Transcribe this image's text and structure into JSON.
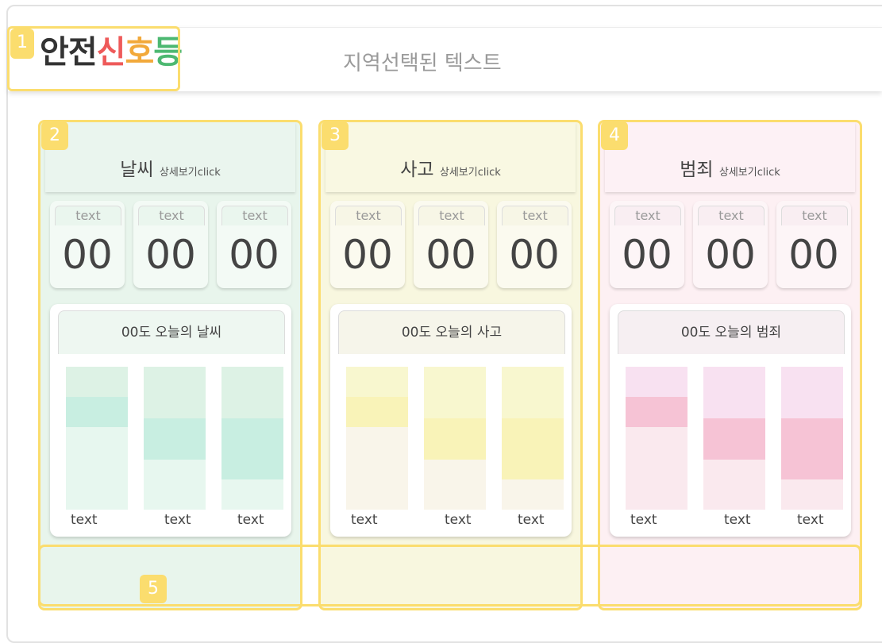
{
  "header": {
    "logo_chars": [
      "안",
      "전",
      "신",
      "호",
      "등"
    ],
    "logo_colors": [
      "#333333",
      "#333333",
      "#ee5a5a",
      "#f2a93b",
      "#4cb871"
    ],
    "region_text": "지역선택된 텍스트"
  },
  "annotations": [
    "1",
    "2",
    "3",
    "4",
    "5"
  ],
  "panels": [
    {
      "title": "날씨",
      "detail": "상세보기click",
      "theme": {
        "bg": "#e8f5ec",
        "head": "#eaf5ee",
        "stat_bg": "#f3faf5",
        "stat_top": "#eaf6ee",
        "chart_head": "#eef7f1",
        "bar_base": "#e7f7ef",
        "bar_top": "#ddf2e5",
        "bar_fill": "#c8eee1"
      },
      "stats": [
        {
          "label": "text",
          "value": "00"
        },
        {
          "label": "text",
          "value": "00"
        },
        {
          "label": "text",
          "value": "00"
        }
      ],
      "chart_title": "00도 오늘의 날씨",
      "bars": [
        {
          "label": "text",
          "top": 0.21,
          "fill": 0.21
        },
        {
          "label": "text",
          "top": 0.36,
          "fill": 0.29
        },
        {
          "label": "text",
          "top": 0.36,
          "fill": 0.43
        }
      ]
    },
    {
      "title": "사고",
      "detail": "상세보기click",
      "theme": {
        "bg": "#f8f7df",
        "head": "#f9f8e2",
        "stat_bg": "#fbfaef",
        "stat_top": "#f7f6e6",
        "chart_head": "#f6f5ea",
        "bar_base": "#f9f5ea",
        "bar_top": "#f8f7cf",
        "bar_fill": "#f9f3b8"
      },
      "stats": [
        {
          "label": "text",
          "value": "00"
        },
        {
          "label": "text",
          "value": "00"
        },
        {
          "label": "text",
          "value": "00"
        }
      ],
      "chart_title": "00도 오늘의 사고",
      "bars": [
        {
          "label": "text",
          "top": 0.21,
          "fill": 0.21
        },
        {
          "label": "text",
          "top": 0.36,
          "fill": 0.29
        },
        {
          "label": "text",
          "top": 0.36,
          "fill": 0.43
        }
      ]
    },
    {
      "title": "범죄",
      "detail": "상세보기click",
      "theme": {
        "bg": "#fdf0f3",
        "head": "#fdf1f5",
        "stat_bg": "#fdf5f7",
        "stat_top": "#f9eef2",
        "chart_head": "#f6eff2",
        "bar_base": "#fae9ee",
        "bar_top": "#f8e1f1",
        "bar_fill": "#f6c3d5"
      },
      "stats": [
        {
          "label": "text",
          "value": "00"
        },
        {
          "label": "text",
          "value": "00"
        },
        {
          "label": "text",
          "value": "00"
        }
      ],
      "chart_title": "00도 오늘의 범죄",
      "bars": [
        {
          "label": "text",
          "top": 0.21,
          "fill": 0.21
        },
        {
          "label": "text",
          "top": 0.36,
          "fill": 0.29
        },
        {
          "label": "text",
          "top": 0.36,
          "fill": 0.43
        }
      ]
    }
  ]
}
